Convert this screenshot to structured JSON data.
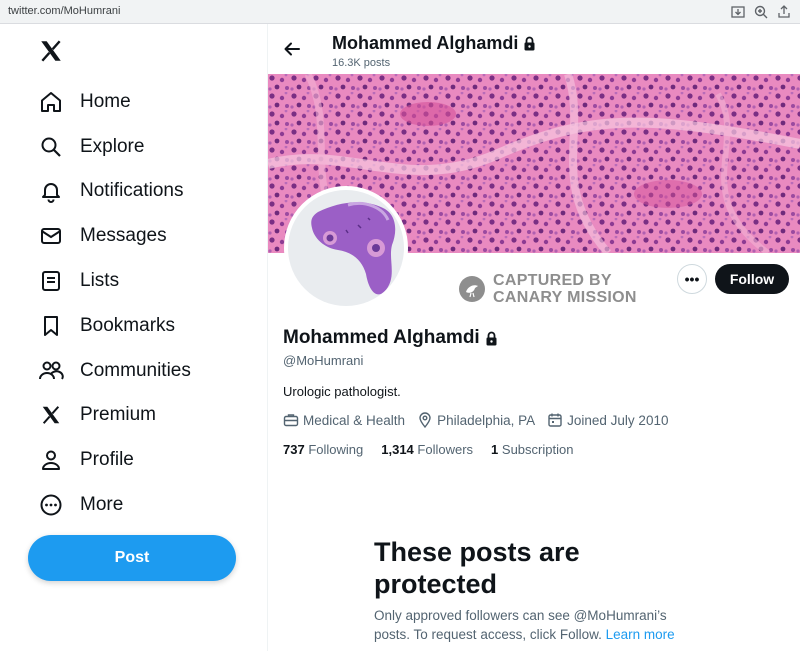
{
  "browser": {
    "url": "twitter.com/MoHumrani",
    "icons": [
      "download-icon",
      "zoom-icon",
      "share-icon"
    ]
  },
  "nav": {
    "items": [
      {
        "label": "Home",
        "icon": "home-icon"
      },
      {
        "label": "Explore",
        "icon": "search-icon"
      },
      {
        "label": "Notifications",
        "icon": "bell-icon"
      },
      {
        "label": "Messages",
        "icon": "envelope-icon"
      },
      {
        "label": "Lists",
        "icon": "list-icon"
      },
      {
        "label": "Bookmarks",
        "icon": "bookmark-icon"
      },
      {
        "label": "Communities",
        "icon": "people-icon"
      },
      {
        "label": "Premium",
        "icon": "x-logo-icon"
      },
      {
        "label": "Profile",
        "icon": "person-icon"
      },
      {
        "label": "More",
        "icon": "more-circle-icon"
      }
    ],
    "post_label": "Post"
  },
  "header": {
    "name": "Mohammed Alghamdi",
    "posts": "16.3K posts"
  },
  "watermark": {
    "line1": "CAPTURED BY",
    "line2": "CANARY MISSION"
  },
  "actions": {
    "more": "•••",
    "follow": "Follow"
  },
  "profile": {
    "name": "Mohammed Alghamdi",
    "handle": "@MoHumrani",
    "bio": "Urologic pathologist.",
    "category": "Medical & Health",
    "location": "Philadelphia, PA",
    "joined": "Joined July 2010",
    "following_count": "737",
    "following_label": "Following",
    "followers_count": "1,314",
    "followers_label": "Followers",
    "subscription_count": "1",
    "subscription_label": "Subscription"
  },
  "protected": {
    "title": "These posts are protected",
    "body": "Only approved followers can see @MoHumrani’s posts. To request access, click Follow.",
    "link": "Learn more"
  },
  "colors": {
    "accent": "#1d9bf0",
    "text": "#0f1419",
    "muted": "#536471",
    "banner_pink": "#d5529c"
  }
}
